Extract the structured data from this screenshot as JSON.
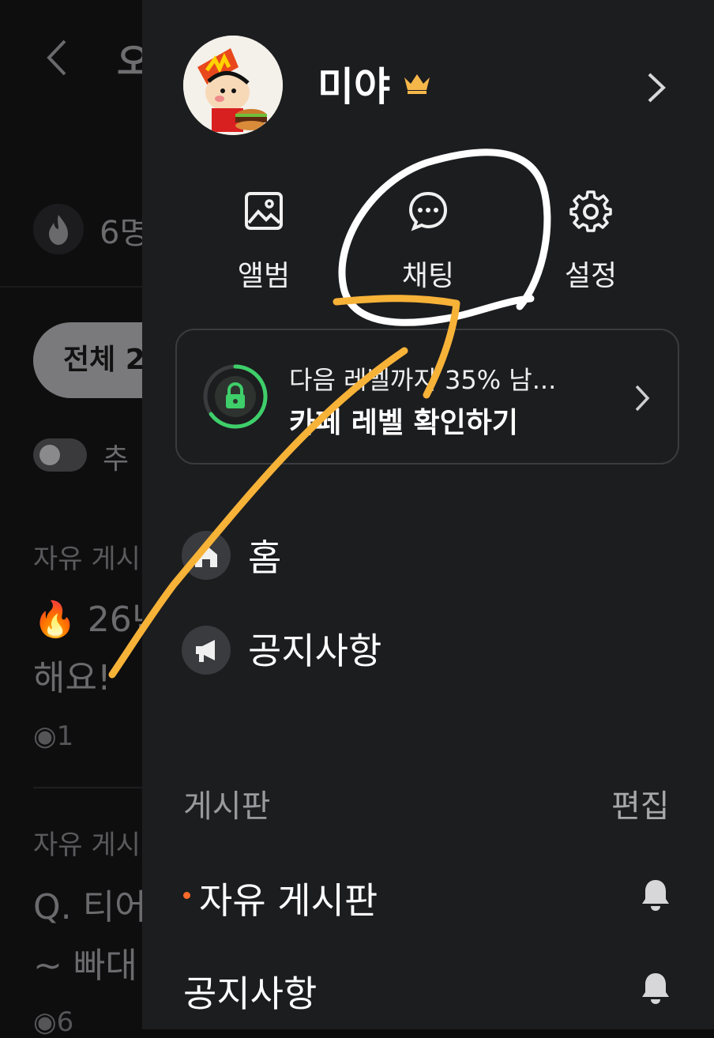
{
  "background_page": {
    "title_partial": "오",
    "members_partial": "6명",
    "filter_chip": "전체 2",
    "toggle_label_partial": "추",
    "posts": [
      {
        "category": "자유 게시",
        "line1": "🔥 26년",
        "line2": "해요!",
        "views": "1"
      },
      {
        "category": "자유 게시",
        "line1": "Q. 티어",
        "line2": "~ 빠대",
        "views": "6"
      }
    ]
  },
  "drawer": {
    "profile": {
      "name": "미야",
      "badge": "crown-icon",
      "avatar": "avatar-character"
    },
    "quick_actions": [
      {
        "label": "앨범",
        "icon": "image-icon"
      },
      {
        "label": "채팅",
        "icon": "chat-bubble-icon"
      },
      {
        "label": "설정",
        "icon": "gear-icon"
      }
    ],
    "level_card": {
      "progress_text": "다음 레벨까지 35% 남...",
      "action": "카페 레벨 확인하기",
      "progress_fraction": 0.65
    },
    "menu": [
      {
        "label": "홈",
        "icon": "home-icon"
      },
      {
        "label": "공지사항",
        "icon": "megaphone-icon"
      }
    ],
    "boards_section": {
      "title": "게시판",
      "edit_label": "편집",
      "items": [
        {
          "label": "자유 게시판",
          "new_dot": true,
          "icon": "bell-icon"
        },
        {
          "label": "공지사항",
          "new_dot": false,
          "icon": "bell-icon"
        }
      ]
    }
  },
  "colors": {
    "drawer_bg": "#1c1d1f",
    "accent_green": "#3ecf6a",
    "new_dot": "#ff6a2b",
    "crown": "#f5b74a",
    "annotation_white": "#ffffff",
    "annotation_orange": "#f7b238"
  }
}
